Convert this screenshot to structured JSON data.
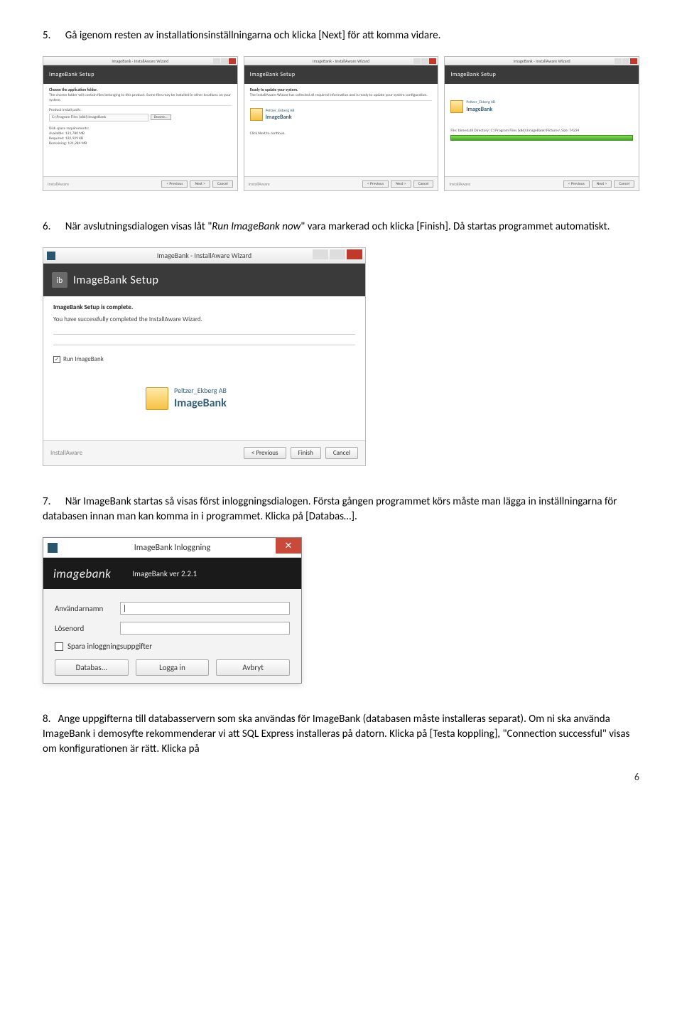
{
  "step5": {
    "num": "5.",
    "text_a": "Gå igenom resten av installationsinställningarna och klicka [Next] för att komma vidare."
  },
  "miniWindows": {
    "title": "ImageBank - InstallAware Wizard",
    "banner": "ImageBank Setup",
    "w1": {
      "head": "Choose the application folder.",
      "desc": "The chosen folder will contain files belonging to this product. Some files may be installed in other locations on your system.",
      "pathLabel": "Product install path:",
      "path": "C:\\Program Files (x86)\\ImageBank",
      "browse": "Browse...",
      "diskHead": "Disk space requirements:",
      "d1": "Available:    131,780 MB",
      "d2": "Required:     122,929 KB",
      "d3": "Remaining:    131,284 MB"
    },
    "w2": {
      "head": "Ready to update your system.",
      "desc": "The InstallAware Wizard has collected all required information and is ready to update your system configuration.",
      "hint": "Click Next to continue.",
      "brandTop": "Peltzer_Ekberg AB",
      "brandMain": "ImageBank"
    },
    "w3": {
      "fileLine": "File: bimesLdll  Directory: C:\\Program Files (x86)\\ImageBank\\Pictures\\  Size: 74234",
      "brandTop": "Peltzer_Ekberg AB",
      "brandMain": "ImageBank"
    },
    "foot": {
      "left": "InstallAware",
      "prev": "< Previous",
      "next": "Next >",
      "cancel": "Cancel"
    }
  },
  "step6": {
    "num": "6.",
    "text_a": "När avslutningsdialogen visas låt ",
    "text_italic": "Run ImageBank now",
    "text_b": " vara markerad och klicka [Finish]. Då startas programmet automatiskt."
  },
  "bigWindow": {
    "title": "ImageBank - InstallAware Wizard",
    "banner": "ImageBank Setup",
    "head": "ImageBank Setup is complete.",
    "desc": "You have successfully completed the InstallAware Wizard.",
    "checkLabel": "Run ImageBank",
    "brandTop": "Peltzer_Ekberg AB",
    "brandMain": "ImageBank",
    "footLeft": "InstallAware",
    "prev": "< Previous",
    "finish": "Finish",
    "cancel": "Cancel"
  },
  "step7": {
    "num": "7.",
    "text": "När ImageBank startas så visas först inloggningsdialogen. Första gången programmet körs måste man lägga in inställningarna för databasen innan man kan komma in i programmet. Klicka på [Databas…]."
  },
  "login": {
    "title": "ImageBank Inloggning",
    "logo": "imagebank",
    "version": "ImageBank ver 2.2.1",
    "userLabel": "Användarnamn",
    "passLabel": "Lösenord",
    "save": "Spara inloggningsuppgifter",
    "btnDb": "Databas...",
    "btnLogin": "Logga in",
    "btnCancel": "Avbryt"
  },
  "step8": {
    "num": "8.",
    "text": "Ange uppgifterna till databasservern som ska användas för ImageBank (databasen måste installeras separat). Om ni ska använda ImageBank i demosyfte rekommenderar vi att SQL Express installeras på datorn. Klicka på [Testa koppling], \"Connection successful\" visas om konfigurationen är rätt. Klicka på"
  },
  "pageNumber": "6"
}
